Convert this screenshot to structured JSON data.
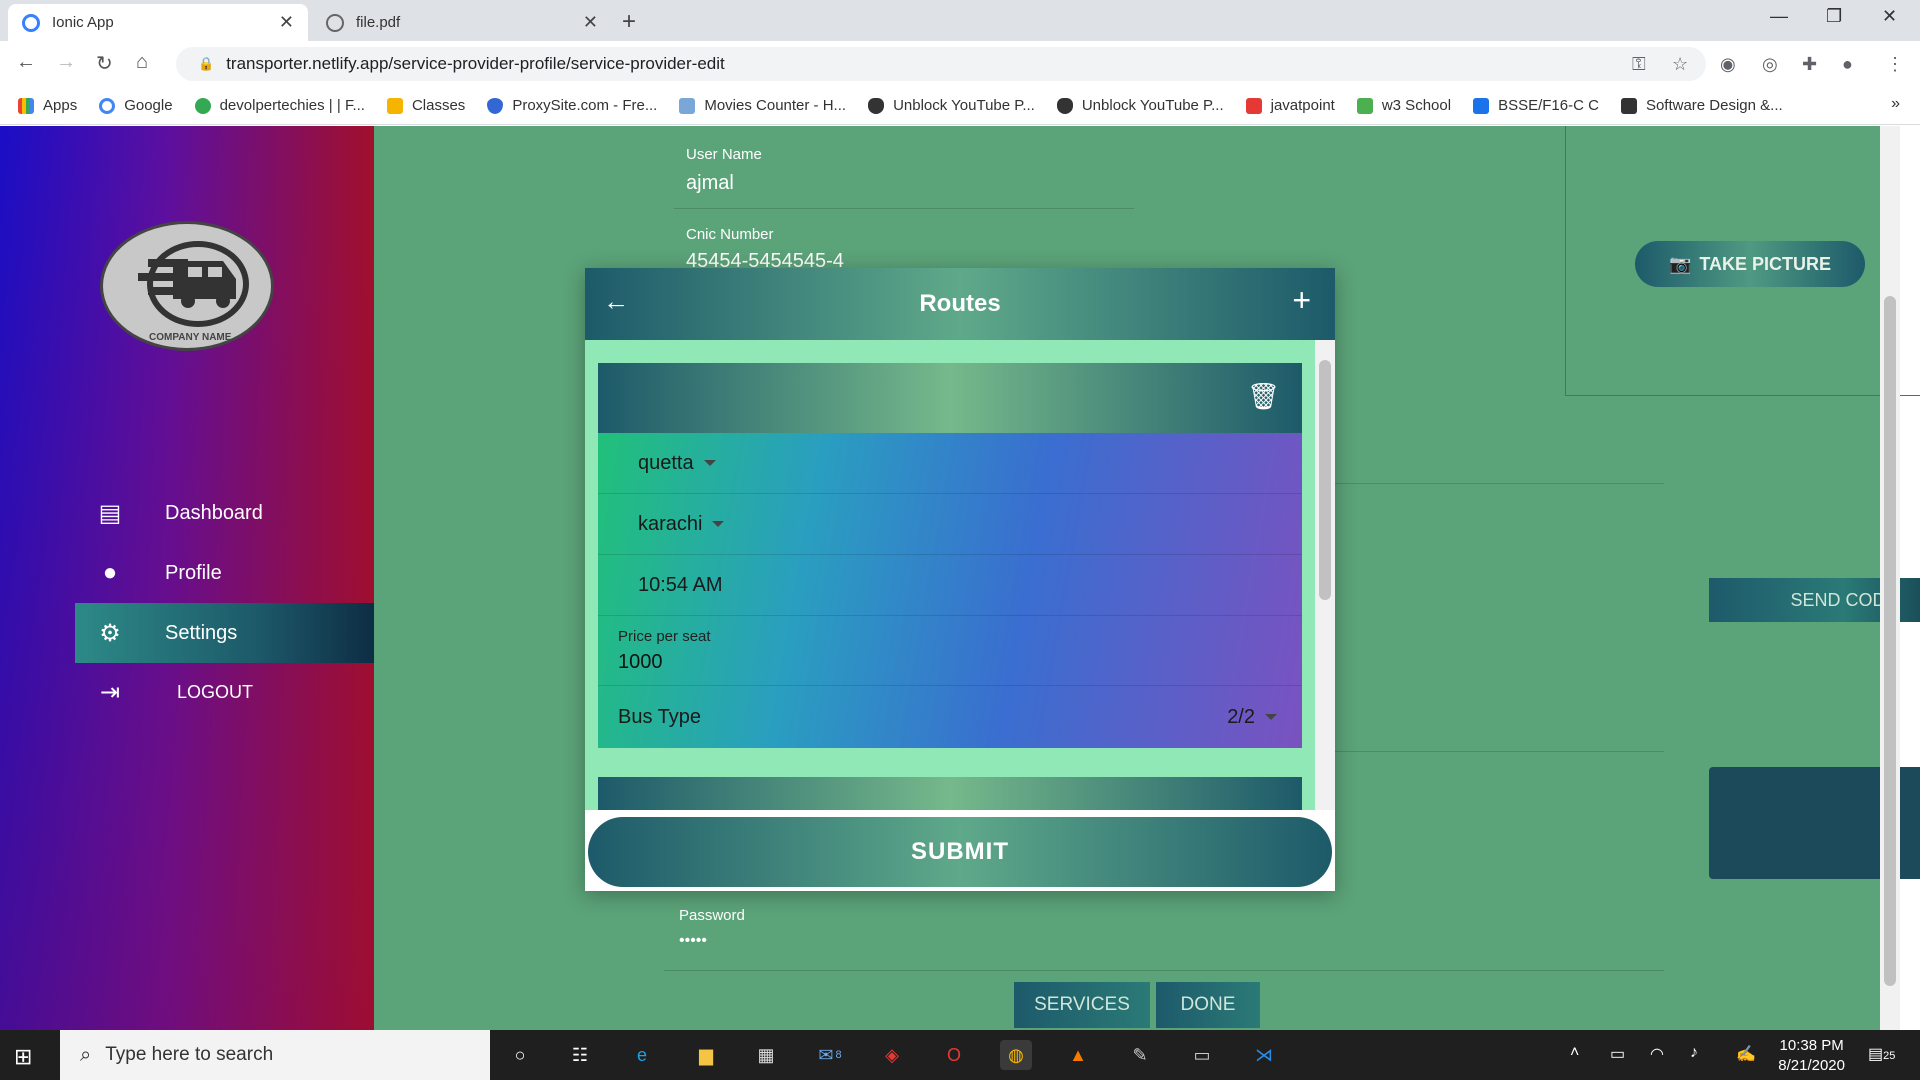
{
  "browser": {
    "tabs": [
      {
        "title": "Ionic App",
        "active": true
      },
      {
        "title": "file.pdf",
        "active": false
      }
    ],
    "url": "transporter.netlify.app/service-provider-profile/service-provider-edit",
    "bookmarks": [
      "Apps",
      "Google",
      "devolpertechies | | F...",
      "Classes",
      "ProxySite.com - Fre...",
      "Movies Counter - H...",
      "Unblock YouTube P...",
      "Unblock YouTube P...",
      "javatpoint",
      "w3 School",
      "BSSE/F16-C C",
      "Software Design &..."
    ]
  },
  "sidebar": {
    "logo_text": "COMPANY NAME",
    "items": [
      {
        "label": "Dashboard",
        "icon": "easel-icon"
      },
      {
        "label": "Profile",
        "icon": "person-icon"
      },
      {
        "label": "Settings",
        "icon": "gear-icon",
        "active": true
      },
      {
        "label": "LOGOUT",
        "icon": "logout-icon"
      }
    ]
  },
  "form": {
    "username_label": "User Name",
    "username_value": "ajmal",
    "cnic_label": "Cnic Number",
    "cnic_value": "45454-5454545-4",
    "take_picture": "TAKE PICTURE",
    "send_code": "SEND CODE",
    "password_label": "Password",
    "password_value": "•••••",
    "services_button": "SERVICES",
    "done_button": "DONE"
  },
  "modal": {
    "title": "Routes",
    "route": {
      "from": "quetta",
      "to": "karachi",
      "time": "10:54 AM",
      "price_label": "Price per seat",
      "price_value": "1000",
      "bus_type_label": "Bus Type",
      "bus_type_value": "2/2"
    },
    "submit": "SUBMIT"
  },
  "taskbar": {
    "search_placeholder": "Type here to search",
    "mail_badge": "8",
    "time": "10:38 PM",
    "date": "8/21/2020",
    "notifications": "25"
  }
}
